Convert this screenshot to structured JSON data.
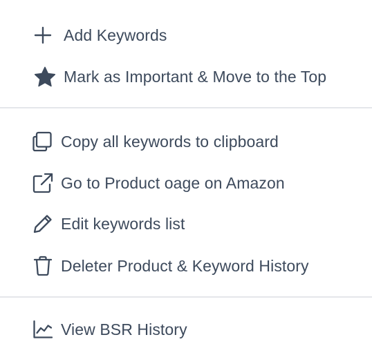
{
  "menu": {
    "items": [
      {
        "label": "Add Keywords",
        "icon": "plus-icon"
      },
      {
        "label": "Mark as Important & Move to the Top",
        "icon": "star-icon"
      },
      {
        "label": "Copy all keywords to clipboard",
        "icon": "copy-icon"
      },
      {
        "label": "Go to Product oage on Amazon",
        "icon": "external-link-icon"
      },
      {
        "label": "Edit keywords list",
        "icon": "pencil-icon"
      },
      {
        "label": "Deleter Product & Keyword History",
        "icon": "trash-icon"
      },
      {
        "label": "View BSR History",
        "icon": "line-chart-icon"
      }
    ]
  },
  "colors": {
    "text": "#3d4a5c",
    "divider": "#e4e6ea",
    "background": "#ffffff"
  }
}
